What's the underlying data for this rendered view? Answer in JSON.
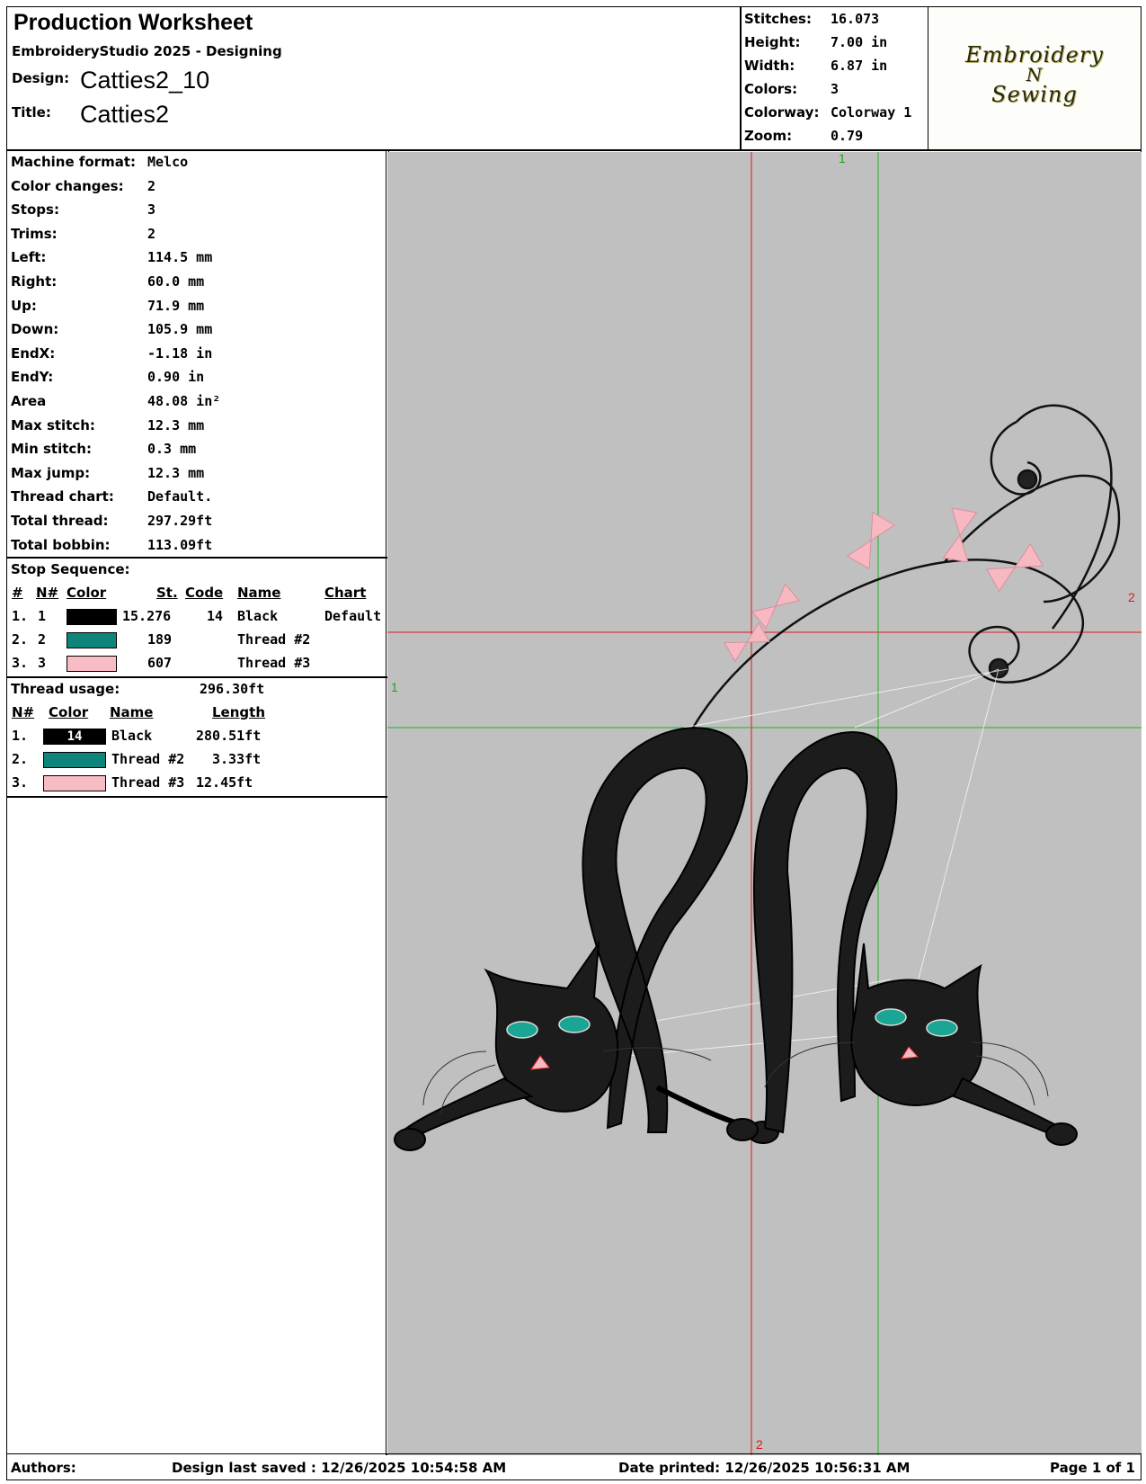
{
  "header": {
    "title": "Production Worksheet",
    "subtitle": "EmbroideryStudio 2025 - Designing",
    "design_label": "Design:",
    "design_value": "Catties2_10",
    "title_label": "Title:",
    "title_value": "Catties2"
  },
  "summary": {
    "rows": [
      {
        "label": "Stitches:",
        "value": "16.073"
      },
      {
        "label": "Height:",
        "value": "7.00 in"
      },
      {
        "label": "Width:",
        "value": "6.87 in"
      },
      {
        "label": "Colors:",
        "value": "3"
      },
      {
        "label": "Colorway:",
        "value": "Colorway 1"
      },
      {
        "label": "Zoom:",
        "value": "0.79"
      }
    ]
  },
  "logo": {
    "line1": "Embroidery",
    "line2": "N",
    "line3": "Sewing"
  },
  "machine": {
    "rows": [
      {
        "label": "Machine format:",
        "value": "Melco"
      },
      {
        "label": "Color changes:",
        "value": "2"
      },
      {
        "label": "Stops:",
        "value": "3"
      },
      {
        "label": "Trims:",
        "value": "2"
      },
      {
        "label": "Left:",
        "value": "114.5 mm"
      },
      {
        "label": "Right:",
        "value": "60.0 mm"
      },
      {
        "label": "Up:",
        "value": "71.9 mm"
      },
      {
        "label": "Down:",
        "value": "105.9 mm"
      },
      {
        "label": "EndX:",
        "value": "-1.18 in"
      },
      {
        "label": "EndY:",
        "value": "0.90 in"
      },
      {
        "label": "Area",
        "value": " 48.08 in²"
      },
      {
        "label": "Max stitch:",
        "value": "12.3 mm"
      },
      {
        "label": "Min stitch:",
        "value": "0.3 mm"
      },
      {
        "label": "Max jump:",
        "value": "12.3 mm"
      },
      {
        "label": "Thread chart:",
        "value": "Default."
      },
      {
        "label": "Total thread:",
        "value": "297.29ft"
      },
      {
        "label": "Total bobbin:",
        "value": "113.09ft"
      }
    ]
  },
  "stop_sequence": {
    "heading": "Stop Sequence:",
    "headers": {
      "num": "#",
      "n": "N#",
      "color": "Color",
      "st": "St.",
      "code": "Code",
      "name": "Name",
      "chart": "Chart"
    },
    "rows": [
      {
        "num": "1.",
        "n": "1",
        "color": "#000000",
        "st": "15.276",
        "code": "14",
        "name": "Black",
        "chart": "Default"
      },
      {
        "num": "2.",
        "n": "2",
        "color": "#0e857a",
        "st": "189",
        "code": "",
        "name": "Thread #2",
        "chart": ""
      },
      {
        "num": "3.",
        "n": "3",
        "color": "#f8bcc4",
        "st": "607",
        "code": "",
        "name": "Thread #3",
        "chart": ""
      }
    ]
  },
  "thread_usage": {
    "heading": "Thread usage:",
    "total": "296.30ft",
    "headers": {
      "n": "N#",
      "color": "Color",
      "name": "Name",
      "length": "Length"
    },
    "rows": [
      {
        "n": "1.",
        "color": "#000000",
        "code": "14",
        "name": "Black",
        "length": "280.51ft"
      },
      {
        "n": "2.",
        "color": "#0e857a",
        "code": "",
        "name": "Thread #2",
        "length": "3.33ft"
      },
      {
        "n": "3.",
        "color": "#f8bcc4",
        "code": "",
        "name": "Thread #3",
        "length": "12.45ft"
      }
    ]
  },
  "canvas": {
    "axis_label_1": "1",
    "axis_label_2": "2",
    "background": "#c0c0c0"
  },
  "footer": {
    "authors": "Authors:",
    "saved": "Design last saved : 12/26/2025 10:54:58 AM",
    "printed": "Date printed: 12/26/2025 10:56:31 AM",
    "page": "Page 1 of 1"
  }
}
